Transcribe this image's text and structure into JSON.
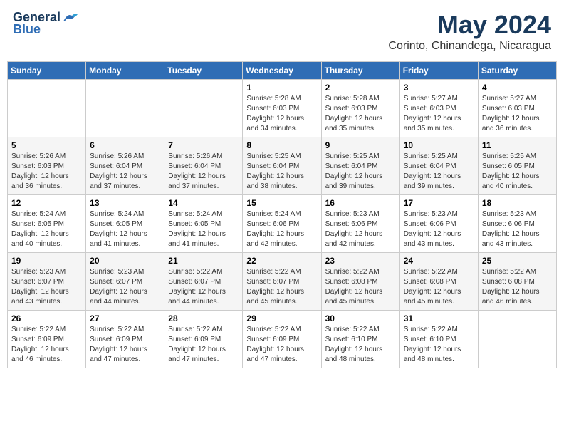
{
  "header": {
    "logo_general": "General",
    "logo_blue": "Blue",
    "month_title": "May 2024",
    "location": "Corinto, Chinandega, Nicaragua"
  },
  "days_of_week": [
    "Sunday",
    "Monday",
    "Tuesday",
    "Wednesday",
    "Thursday",
    "Friday",
    "Saturday"
  ],
  "weeks": [
    [
      {
        "day": "",
        "info": ""
      },
      {
        "day": "",
        "info": ""
      },
      {
        "day": "",
        "info": ""
      },
      {
        "day": "1",
        "info": "Sunrise: 5:28 AM\nSunset: 6:03 PM\nDaylight: 12 hours\nand 34 minutes."
      },
      {
        "day": "2",
        "info": "Sunrise: 5:28 AM\nSunset: 6:03 PM\nDaylight: 12 hours\nand 35 minutes."
      },
      {
        "day": "3",
        "info": "Sunrise: 5:27 AM\nSunset: 6:03 PM\nDaylight: 12 hours\nand 35 minutes."
      },
      {
        "day": "4",
        "info": "Sunrise: 5:27 AM\nSunset: 6:03 PM\nDaylight: 12 hours\nand 36 minutes."
      }
    ],
    [
      {
        "day": "5",
        "info": "Sunrise: 5:26 AM\nSunset: 6:03 PM\nDaylight: 12 hours\nand 36 minutes."
      },
      {
        "day": "6",
        "info": "Sunrise: 5:26 AM\nSunset: 6:04 PM\nDaylight: 12 hours\nand 37 minutes."
      },
      {
        "day": "7",
        "info": "Sunrise: 5:26 AM\nSunset: 6:04 PM\nDaylight: 12 hours\nand 37 minutes."
      },
      {
        "day": "8",
        "info": "Sunrise: 5:25 AM\nSunset: 6:04 PM\nDaylight: 12 hours\nand 38 minutes."
      },
      {
        "day": "9",
        "info": "Sunrise: 5:25 AM\nSunset: 6:04 PM\nDaylight: 12 hours\nand 39 minutes."
      },
      {
        "day": "10",
        "info": "Sunrise: 5:25 AM\nSunset: 6:04 PM\nDaylight: 12 hours\nand 39 minutes."
      },
      {
        "day": "11",
        "info": "Sunrise: 5:25 AM\nSunset: 6:05 PM\nDaylight: 12 hours\nand 40 minutes."
      }
    ],
    [
      {
        "day": "12",
        "info": "Sunrise: 5:24 AM\nSunset: 6:05 PM\nDaylight: 12 hours\nand 40 minutes."
      },
      {
        "day": "13",
        "info": "Sunrise: 5:24 AM\nSunset: 6:05 PM\nDaylight: 12 hours\nand 41 minutes."
      },
      {
        "day": "14",
        "info": "Sunrise: 5:24 AM\nSunset: 6:05 PM\nDaylight: 12 hours\nand 41 minutes."
      },
      {
        "day": "15",
        "info": "Sunrise: 5:24 AM\nSunset: 6:06 PM\nDaylight: 12 hours\nand 42 minutes."
      },
      {
        "day": "16",
        "info": "Sunrise: 5:23 AM\nSunset: 6:06 PM\nDaylight: 12 hours\nand 42 minutes."
      },
      {
        "day": "17",
        "info": "Sunrise: 5:23 AM\nSunset: 6:06 PM\nDaylight: 12 hours\nand 43 minutes."
      },
      {
        "day": "18",
        "info": "Sunrise: 5:23 AM\nSunset: 6:06 PM\nDaylight: 12 hours\nand 43 minutes."
      }
    ],
    [
      {
        "day": "19",
        "info": "Sunrise: 5:23 AM\nSunset: 6:07 PM\nDaylight: 12 hours\nand 43 minutes."
      },
      {
        "day": "20",
        "info": "Sunrise: 5:23 AM\nSunset: 6:07 PM\nDaylight: 12 hours\nand 44 minutes."
      },
      {
        "day": "21",
        "info": "Sunrise: 5:22 AM\nSunset: 6:07 PM\nDaylight: 12 hours\nand 44 minutes."
      },
      {
        "day": "22",
        "info": "Sunrise: 5:22 AM\nSunset: 6:07 PM\nDaylight: 12 hours\nand 45 minutes."
      },
      {
        "day": "23",
        "info": "Sunrise: 5:22 AM\nSunset: 6:08 PM\nDaylight: 12 hours\nand 45 minutes."
      },
      {
        "day": "24",
        "info": "Sunrise: 5:22 AM\nSunset: 6:08 PM\nDaylight: 12 hours\nand 45 minutes."
      },
      {
        "day": "25",
        "info": "Sunrise: 5:22 AM\nSunset: 6:08 PM\nDaylight: 12 hours\nand 46 minutes."
      }
    ],
    [
      {
        "day": "26",
        "info": "Sunrise: 5:22 AM\nSunset: 6:09 PM\nDaylight: 12 hours\nand 46 minutes."
      },
      {
        "day": "27",
        "info": "Sunrise: 5:22 AM\nSunset: 6:09 PM\nDaylight: 12 hours\nand 47 minutes."
      },
      {
        "day": "28",
        "info": "Sunrise: 5:22 AM\nSunset: 6:09 PM\nDaylight: 12 hours\nand 47 minutes."
      },
      {
        "day": "29",
        "info": "Sunrise: 5:22 AM\nSunset: 6:09 PM\nDaylight: 12 hours\nand 47 minutes."
      },
      {
        "day": "30",
        "info": "Sunrise: 5:22 AM\nSunset: 6:10 PM\nDaylight: 12 hours\nand 48 minutes."
      },
      {
        "day": "31",
        "info": "Sunrise: 5:22 AM\nSunset: 6:10 PM\nDaylight: 12 hours\nand 48 minutes."
      },
      {
        "day": "",
        "info": ""
      }
    ]
  ]
}
